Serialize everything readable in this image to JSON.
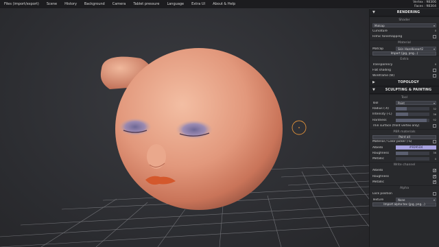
{
  "menubar": {
    "items": [
      "Files (import/export)",
      "Scene",
      "History",
      "Background",
      "Camera",
      "Tablet pressure",
      "Language",
      "Extra UI",
      "About & Help"
    ]
  },
  "stats": {
    "vertex": "Vertex : 98306",
    "faces": "Faces : 98304"
  },
  "panel": {
    "rendering": {
      "title": "RENDERING",
      "shader_title": "Shader",
      "shader_value": "Matcap",
      "curvature_label": "Curvature",
      "curvature_value": "0",
      "filmic_label": "Filmic tonemapping",
      "material_title": "Material",
      "matcap_label": "Matcap",
      "matcap_value": "Skin Hazelkiseart2",
      "import_label": "Import (jpg, png...)",
      "extra_title": "Extra",
      "transparency_label": "Transparency",
      "transparency_value": "0",
      "flat_label": "Flat shading",
      "wireframe_label": "Wireframe (W)"
    },
    "topology": {
      "title": "TOPOLOGY"
    },
    "sculpting": {
      "title": "SCULPTING & PAINTING",
      "tool_title": "Tool",
      "tool_label": "Tool",
      "tool_value": "Paint",
      "radius_label": "Radius (-X)",
      "radius_value": "32",
      "intensity_label": "Intensity (-C)",
      "intensity_value": "36",
      "hardness_label": "Hardness",
      "hardness_value": "92",
      "thin_label": "Thin surface (front vertex only)",
      "pbr_title": "PBR materials",
      "paint_all_label": "Paint all",
      "picker_label": "Material / Color picker (-S)",
      "albedo_label": "Albedo",
      "albedo_value": "#9D95D4",
      "roughness_label": "Roughness",
      "roughness_value": "36",
      "metallic_label": "Metallic",
      "metallic_value": "0",
      "write_title": "Write channel",
      "w_albedo_label": "Albedo",
      "w_roughness_label": "Roughness",
      "w_metallic_label": "Metallic",
      "alpha_title": "Alpha",
      "lock_label": "Lock position",
      "texture_label": "Texture",
      "texture_value": "None",
      "import_alpha_label": "Import alpha tex (jpg, png...)"
    }
  },
  "values": {
    "radius": 0.32,
    "intensity": 0.36,
    "hardness": 0.92,
    "roughness": 0.36,
    "metallic": 0.0,
    "transparency": 0.0,
    "curvature": 0.0,
    "filmic": false,
    "flat": false,
    "wireframe": false,
    "thin": false,
    "picker": false,
    "w_albedo": true,
    "w_roughness": true,
    "w_metallic": true,
    "lock": false
  },
  "colors": {
    "accent_cursor": "#e0913a",
    "skin": "#e9a58a",
    "albedo": "#9D95D4"
  },
  "icons": {
    "expanded": "triangle-down-icon",
    "collapsed": "triangle-right-icon"
  }
}
